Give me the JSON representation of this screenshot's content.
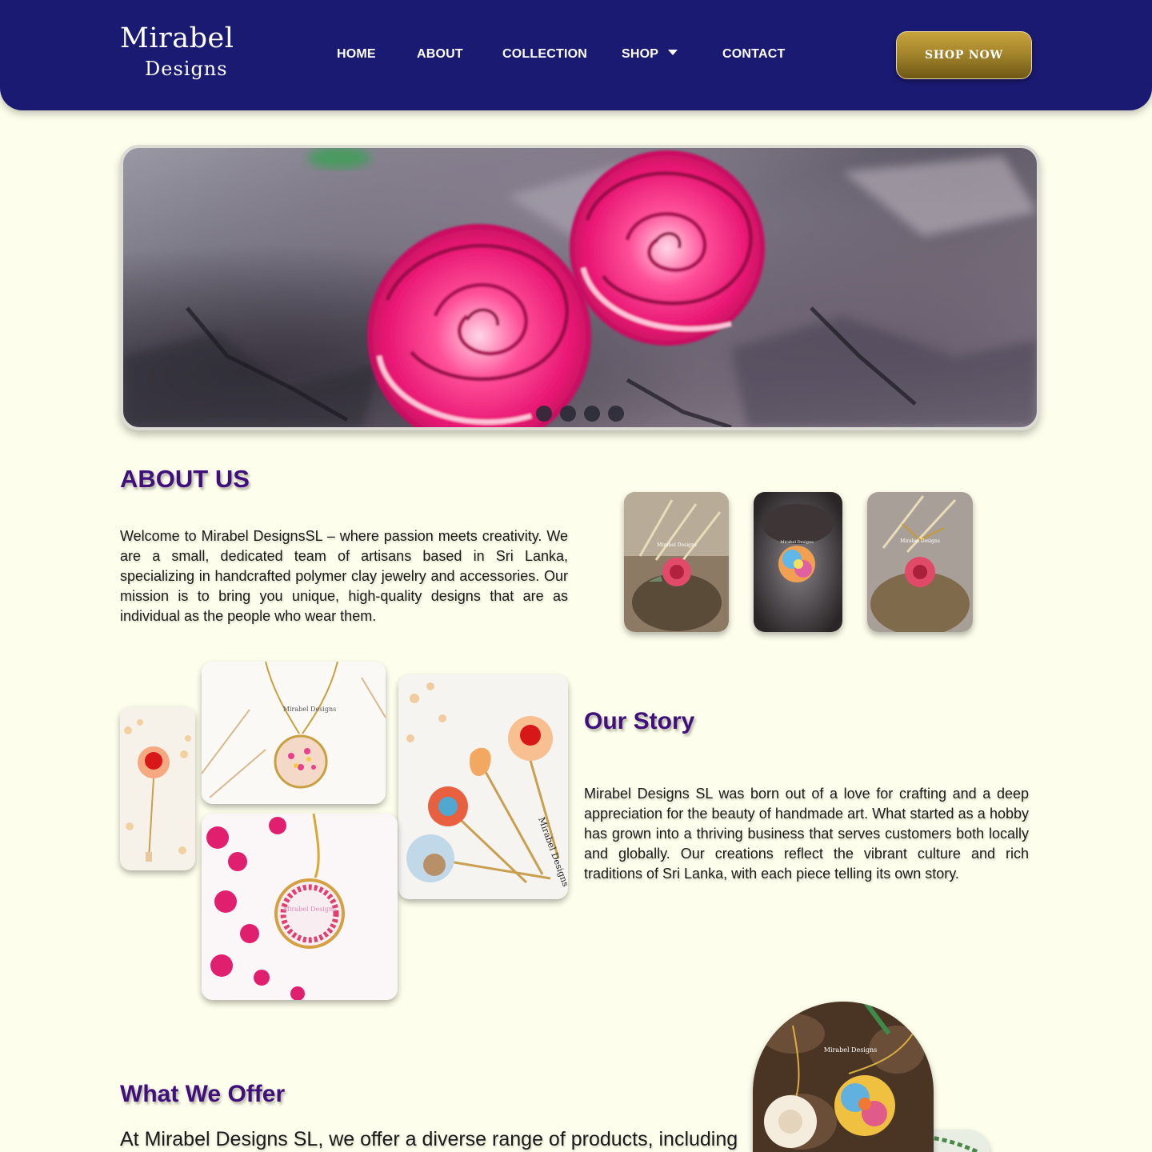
{
  "header": {
    "logo_line1": "Mirabel",
    "logo_line2": "Designs",
    "nav": [
      {
        "label": "HOME"
      },
      {
        "label": "ABOUT"
      },
      {
        "label": "COLLECTION"
      },
      {
        "label": "SHOP",
        "has_dropdown": true
      },
      {
        "label": "CONTACT"
      }
    ],
    "cta_label": "SHOP NOW"
  },
  "hero": {
    "slide_count": 4,
    "active_slide": 1
  },
  "about": {
    "title": "ABOUT US",
    "text": "Welcome to Mirabel DesignsSL – where passion meets creativity. We are a small, dedicated team of artisans based in Sri Lanka, specializing in handcrafted polymer clay jewelry and accessories. Our mission is to bring you unique, high-quality designs that are as individual as the people who wear them.",
    "photo_watermark": "Mirabel Designs"
  },
  "story": {
    "title": "Our Story",
    "text": "Mirabel Designs SL was born out of a love for crafting and a deep appreciation for the beauty of handmade art. What started as a hobby has grown into a thriving business that serves customers both locally and globally. Our creations reflect the vibrant culture and rich traditions of Sri Lanka, with each piece telling its own story.",
    "photo_watermark": "Mirabel Designs"
  },
  "offer": {
    "title": "What We Offer",
    "text": "At Mirabel Designs SL, we offer a diverse range of products, including",
    "photo_watermark": "Mirabel Designs"
  },
  "colors": {
    "header_bg": "#1a1a72",
    "page_bg": "#fefeec",
    "heading": "#3f0f7a",
    "cta_gold": "#a0822a"
  }
}
